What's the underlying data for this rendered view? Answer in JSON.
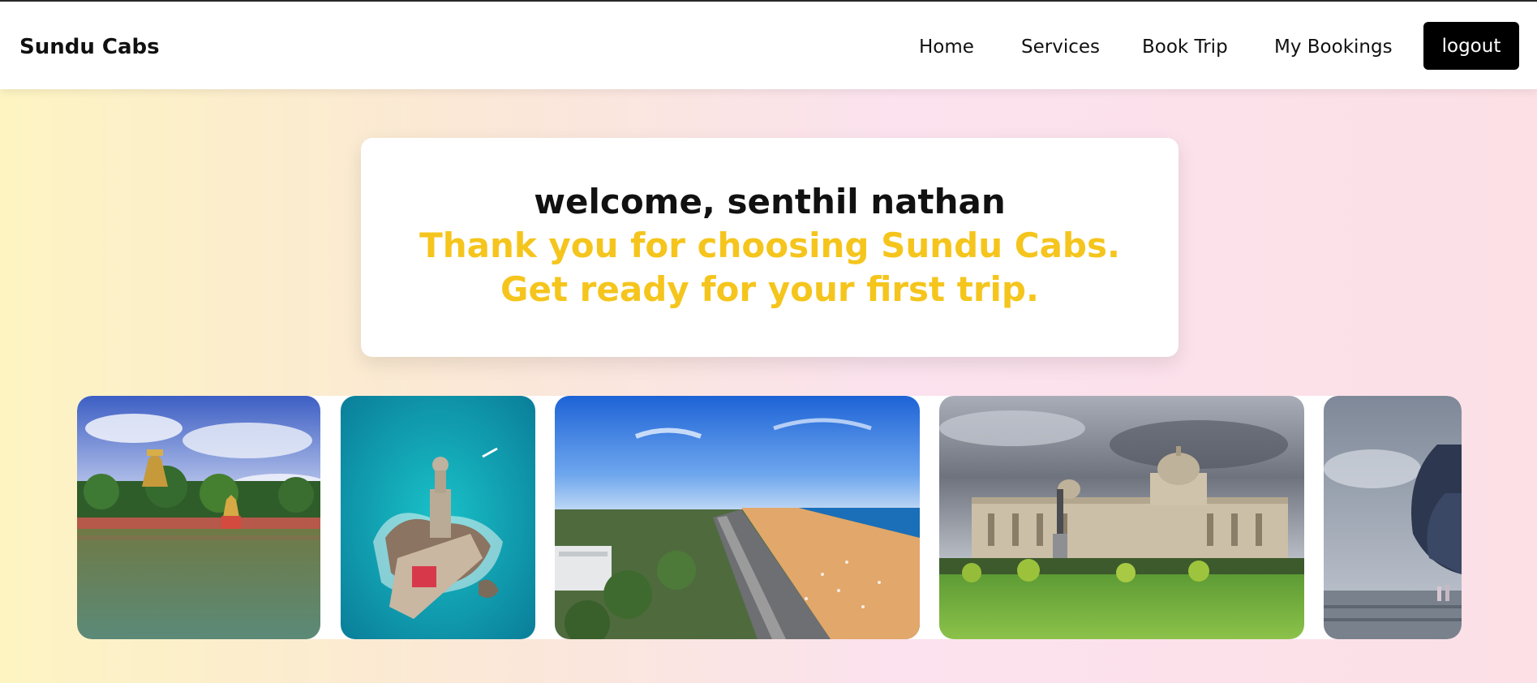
{
  "nav": {
    "brand": "Sundu Cabs",
    "links": [
      "Home",
      "Services",
      "Book Trip",
      "My Bookings"
    ],
    "logout_label": "logout"
  },
  "welcome": {
    "title": "welcome, senthil nathan",
    "message": "Thank you for choosing Sundu Cabs. Get ready for your first trip."
  },
  "gallery": {
    "images": [
      "temple-tank-photo",
      "island-memorial-photo",
      "beach-city-photo",
      "palace-building-photo",
      "statue-photo"
    ]
  },
  "colors": {
    "accent": "#f5c51d",
    "logout_bg": "#000000"
  }
}
